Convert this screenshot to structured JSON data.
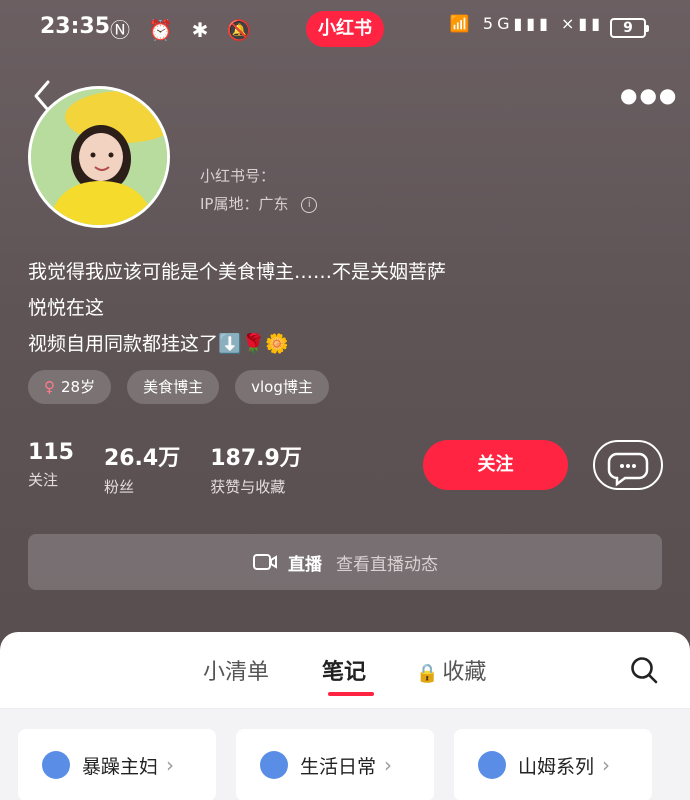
{
  "status": {
    "time": "23:35",
    "left_icons": [
      "nfc-icon",
      "alarm-icon",
      "bluetooth-icon",
      "mute-icon"
    ],
    "app": "小红书",
    "right_icons": [
      "wifi-icon",
      "5g-signal-icon",
      "signal-icon"
    ],
    "battery": "9"
  },
  "profile": {
    "id_label": "小红书号：",
    "ip_label": "IP属地：广东",
    "bio": [
      "我觉得我应该可能是个美食博主……不是关姻菩萨",
      "悦悦在这",
      "视频自用同款都挂这了⬇️🌹🌼"
    ],
    "tags": [
      "28岁",
      "美食博主",
      "vlog博主"
    ]
  },
  "stats": [
    {
      "num": "115",
      "label": "关注"
    },
    {
      "num": "26.4万",
      "label": "粉丝"
    },
    {
      "num": "187.9万",
      "label": "获赞与收藏"
    }
  ],
  "actions": {
    "follow": "关注"
  },
  "live": {
    "label": "直播",
    "sub": "查看直播动态"
  },
  "tabs": [
    {
      "label": "小清单"
    },
    {
      "label": "笔记"
    },
    {
      "label": "收藏"
    }
  ],
  "collections": [
    {
      "label": "暴躁主妇"
    },
    {
      "label": "生活日常"
    },
    {
      "label": "山姆系列"
    }
  ],
  "colors": {
    "accent": "#ff2442",
    "collection_icon": "#5a8ee6"
  }
}
